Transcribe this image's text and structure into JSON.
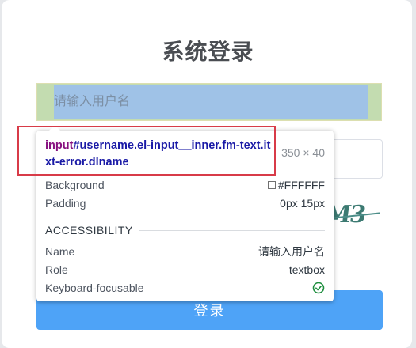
{
  "login": {
    "title": "系统登录",
    "username_placeholder": "请输入用户名",
    "login_label": "登录",
    "captcha_text": "M3"
  },
  "inspector": {
    "tag": "input",
    "selector": "#username.el-input__inner.fm-text.itxt-error.dlname",
    "dimensions": "350 × 40",
    "rows": [
      {
        "key": "Background",
        "value": "#FFFFFF"
      },
      {
        "key": "Padding",
        "value": "0px 15px"
      }
    ],
    "section_title": "ACCESSIBILITY",
    "accessibility": [
      {
        "key": "Name",
        "value": "请输入用户名"
      },
      {
        "key": "Role",
        "value": "textbox"
      },
      {
        "key": "Keyboard-focusable",
        "value": ""
      }
    ],
    "focusable_icon": "check-circle-icon"
  },
  "colors": {
    "accent": "#4ea3f7",
    "highlight_content": "#9fc2e7",
    "highlight_padding": "#c3dcb0",
    "annotation_box": "#d83b48",
    "check": "#1e8e3e"
  }
}
